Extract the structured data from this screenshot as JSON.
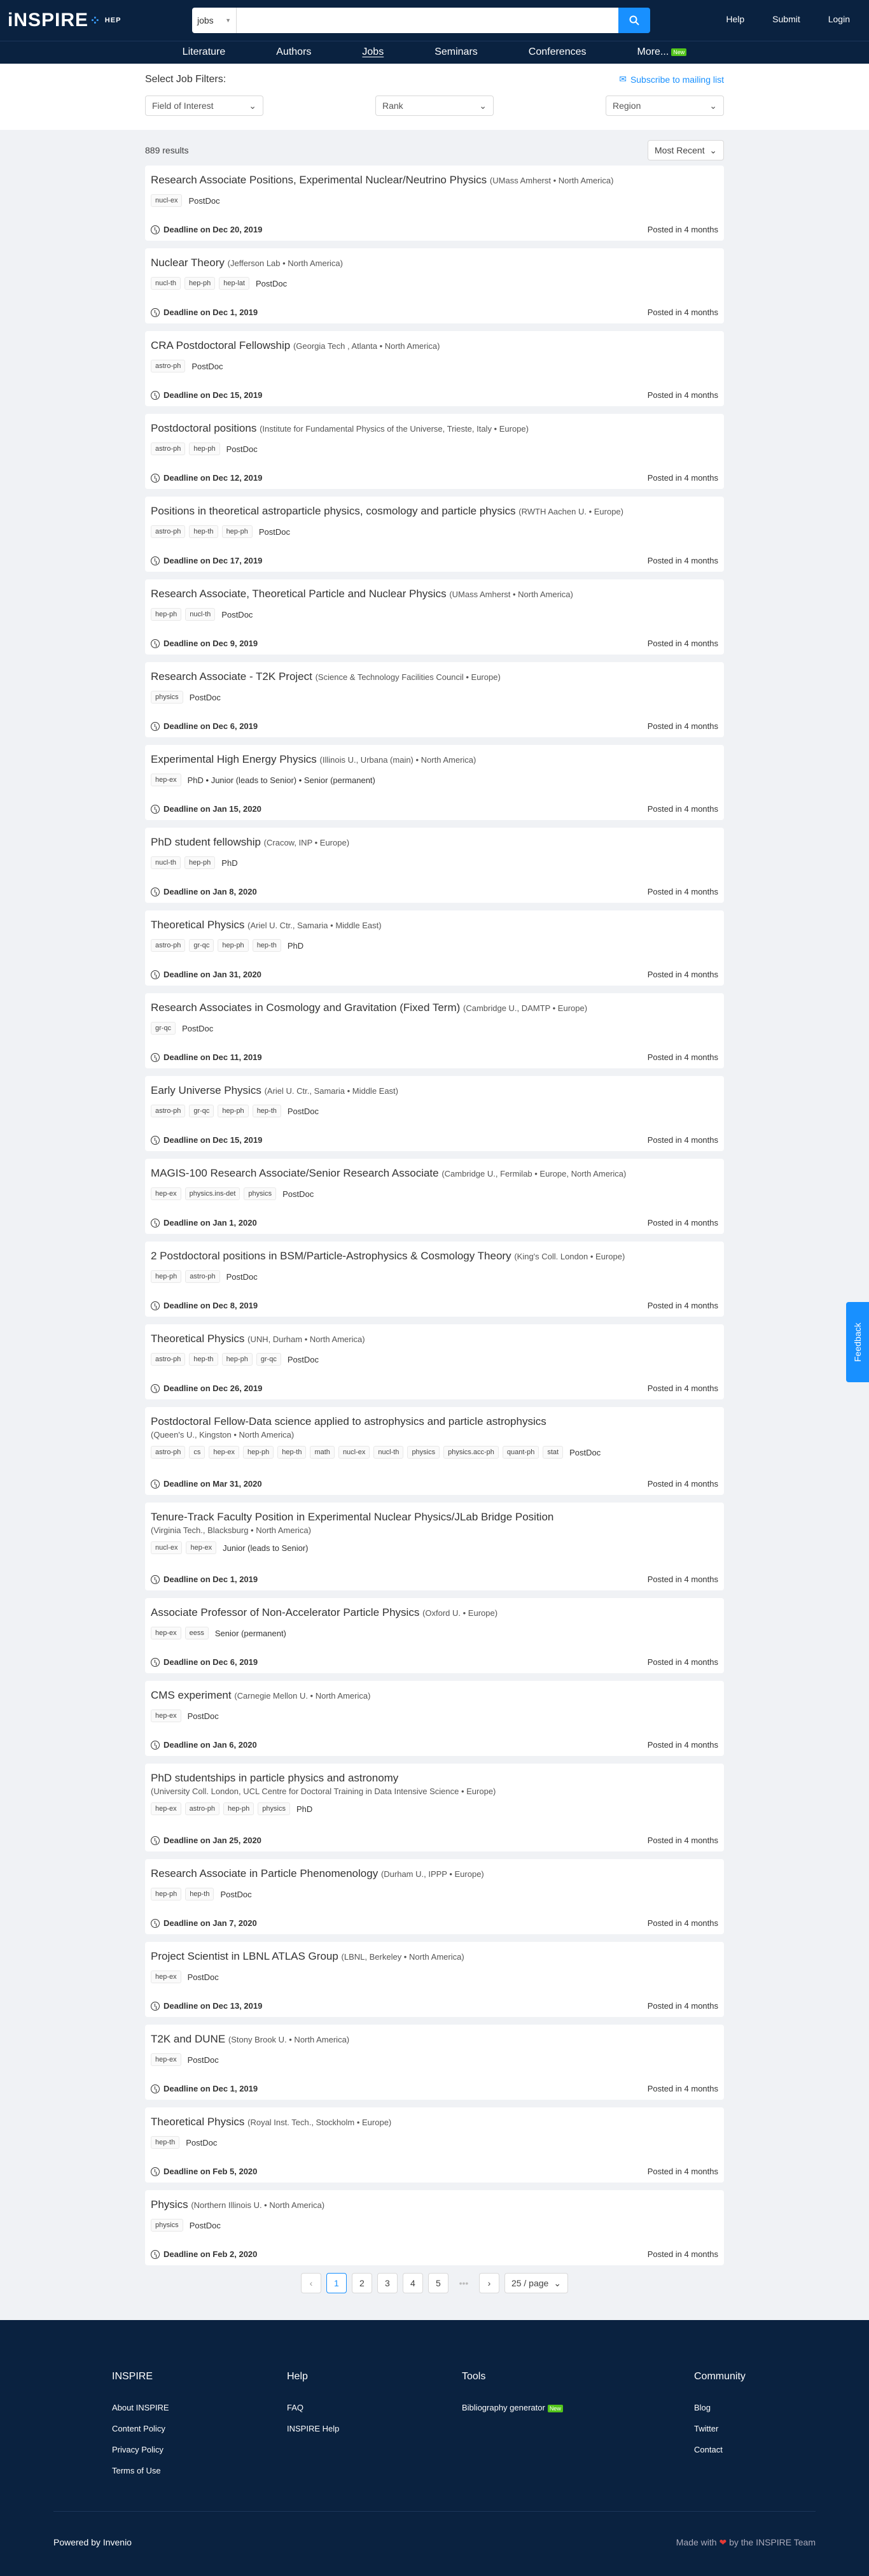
{
  "header": {
    "logo": "iNSPIRE",
    "logo_sub": "HEP",
    "search_scope": "jobs",
    "search_placeholder": "",
    "links": [
      "Help",
      "Submit",
      "Login"
    ],
    "nav": [
      "Literature",
      "Authors",
      "Jobs",
      "Seminars",
      "Conferences",
      "More..."
    ],
    "nav_new_badge": "New"
  },
  "filters": {
    "title": "Select Job Filters:",
    "subscribe": "Subscribe to mailing list",
    "field": "Field of Interest",
    "rank": "Rank",
    "region": "Region"
  },
  "results": {
    "count": "889 results",
    "sort": "Most Recent"
  },
  "jobs": [
    {
      "title": "Research Associate Positions, Experimental Nuclear/Neutrino Physics",
      "inst": "(UMass Amherst • North America)",
      "tags": [
        "nucl-ex"
      ],
      "rank": "PostDoc",
      "deadline": "Deadline on Dec 20, 2019",
      "posted": "Posted in 4 months"
    },
    {
      "title": "Nuclear Theory",
      "inst": "(Jefferson Lab • North America)",
      "tags": [
        "nucl-th",
        "hep-ph",
        "hep-lat"
      ],
      "rank": "PostDoc",
      "deadline": "Deadline on Dec 1, 2019",
      "posted": "Posted in 4 months"
    },
    {
      "title": "CRA Postdoctoral Fellowship",
      "inst": "(Georgia Tech , Atlanta • North America)",
      "tags": [
        "astro-ph"
      ],
      "rank": "PostDoc",
      "deadline": "Deadline on Dec 15, 2019",
      "posted": "Posted in 4 months"
    },
    {
      "title": "Postdoctoral positions",
      "inst": "(Institute for Fundamental Physics of the Universe, Trieste, Italy • Europe)",
      "tags": [
        "astro-ph",
        "hep-ph"
      ],
      "rank": "PostDoc",
      "deadline": "Deadline on Dec 12, 2019",
      "posted": "Posted in 4 months"
    },
    {
      "title": "Positions in theoretical astroparticle physics, cosmology and particle physics",
      "inst": "(RWTH Aachen U. • Europe)",
      "tags": [
        "astro-ph",
        "hep-th",
        "hep-ph"
      ],
      "rank": "PostDoc",
      "deadline": "Deadline on Dec 17, 2019",
      "posted": "Posted in 4 months"
    },
    {
      "title": "Research Associate, Theoretical Particle and Nuclear Physics",
      "inst": "(UMass Amherst • North America)",
      "tags": [
        "hep-ph",
        "nucl-th"
      ],
      "rank": "PostDoc",
      "deadline": "Deadline on Dec 9, 2019",
      "posted": "Posted in 4 months"
    },
    {
      "title": "Research Associate - T2K Project",
      "inst": "(Science & Technology Facilities Council • Europe)",
      "tags": [
        "physics"
      ],
      "rank": "PostDoc",
      "deadline": "Deadline on Dec 6, 2019",
      "posted": "Posted in 4 months"
    },
    {
      "title": "Experimental High Energy Physics",
      "inst": "(Illinois U., Urbana (main) • North America)",
      "tags": [
        "hep-ex"
      ],
      "rank": "PhD • Junior (leads to Senior) • Senior (permanent)",
      "deadline": "Deadline on Jan 15, 2020",
      "posted": "Posted in 4 months"
    },
    {
      "title": "PhD student fellowship",
      "inst": "(Cracow, INP • Europe)",
      "tags": [
        "nucl-th",
        "hep-ph"
      ],
      "rank": "PhD",
      "deadline": "Deadline on Jan 8, 2020",
      "posted": "Posted in 4 months"
    },
    {
      "title": "Theoretical Physics",
      "inst": "(Ariel U. Ctr., Samaria • Middle East)",
      "tags": [
        "astro-ph",
        "gr-qc",
        "hep-ph",
        "hep-th"
      ],
      "rank": "PhD",
      "deadline": "Deadline on Jan 31, 2020",
      "posted": "Posted in 4 months"
    },
    {
      "title": "Research Associates in Cosmology and Gravitation (Fixed Term)",
      "inst": "(Cambridge U., DAMTP • Europe)",
      "tags": [
        "gr-qc"
      ],
      "rank": "PostDoc",
      "deadline": "Deadline on Dec 11, 2019",
      "posted": "Posted in 4 months"
    },
    {
      "title": "Early Universe Physics",
      "inst": "(Ariel U. Ctr., Samaria • Middle East)",
      "tags": [
        "astro-ph",
        "gr-qc",
        "hep-ph",
        "hep-th"
      ],
      "rank": "PostDoc",
      "deadline": "Deadline on Dec 15, 2019",
      "posted": "Posted in 4 months"
    },
    {
      "title": "MAGIS-100 Research Associate/Senior Research Associate",
      "inst": "(Cambridge U., Fermilab • Europe, North America)",
      "tags": [
        "hep-ex",
        "physics.ins-det",
        "physics"
      ],
      "rank": "PostDoc",
      "deadline": "Deadline on Jan 1, 2020",
      "posted": "Posted in 4 months"
    },
    {
      "title": "2 Postdoctoral positions in BSM/Particle-Astrophysics & Cosmology Theory",
      "inst": "(King's Coll. London • Europe)",
      "tags": [
        "hep-ph",
        "astro-ph"
      ],
      "rank": "PostDoc",
      "deadline": "Deadline on Dec 8, 2019",
      "posted": "Posted in 4 months"
    },
    {
      "title": "Theoretical Physics",
      "inst": "(UNH, Durham • North America)",
      "tags": [
        "astro-ph",
        "hep-th",
        "hep-ph",
        "gr-qc"
      ],
      "rank": "PostDoc",
      "deadline": "Deadline on Dec 26, 2019",
      "posted": "Posted in 4 months"
    },
    {
      "title": "Postdoctoral Fellow-Data science applied to astrophysics and particle astrophysics",
      "inst2": "(Queen's U., Kingston • North America)",
      "tags": [
        "astro-ph",
        "cs",
        "hep-ex",
        "hep-ph",
        "hep-th",
        "math",
        "nucl-ex",
        "nucl-th",
        "physics",
        "physics.acc-ph",
        "quant-ph",
        "stat"
      ],
      "rank": "PostDoc",
      "deadline": "Deadline on Mar 31, 2020",
      "posted": "Posted in 4 months"
    },
    {
      "title": "Tenure-Track Faculty Position in Experimental Nuclear Physics/JLab Bridge Position",
      "inst2": "(Virginia Tech., Blacksburg • North America)",
      "tags": [
        "nucl-ex",
        "hep-ex"
      ],
      "rank": "Junior (leads to Senior)",
      "deadline": "Deadline on Dec 1, 2019",
      "posted": "Posted in 4 months"
    },
    {
      "title": "Associate Professor of Non-Accelerator Particle Physics",
      "inst": "(Oxford U. • Europe)",
      "tags": [
        "hep-ex",
        "eess"
      ],
      "rank": "Senior (permanent)",
      "deadline": "Deadline on Dec 6, 2019",
      "posted": "Posted in 4 months"
    },
    {
      "title": "CMS experiment",
      "inst": "(Carnegie Mellon U. • North America)",
      "tags": [
        "hep-ex"
      ],
      "rank": "PostDoc",
      "deadline": "Deadline on Jan 6, 2020",
      "posted": "Posted in 4 months"
    },
    {
      "title": "PhD studentships in particle physics and astronomy",
      "inst2": "(University Coll. London, UCL Centre for Doctoral Training in Data Intensive Science • Europe)",
      "tags": [
        "hep-ex",
        "astro-ph",
        "hep-ph",
        "physics"
      ],
      "rank": "PhD",
      "deadline": "Deadline on Jan 25, 2020",
      "posted": "Posted in 4 months"
    },
    {
      "title": "Research Associate in Particle Phenomenology",
      "inst": "(Durham U., IPPP • Europe)",
      "tags": [
        "hep-ph",
        "hep-th"
      ],
      "rank": "PostDoc",
      "deadline": "Deadline on Jan 7, 2020",
      "posted": "Posted in 4 months"
    },
    {
      "title": "Project Scientist in LBNL ATLAS Group",
      "inst": "(LBNL, Berkeley • North America)",
      "tags": [
        "hep-ex"
      ],
      "rank": "PostDoc",
      "deadline": "Deadline on Dec 13, 2019",
      "posted": "Posted in 4 months"
    },
    {
      "title": "T2K and DUNE",
      "inst": "(Stony Brook U. • North America)",
      "tags": [
        "hep-ex"
      ],
      "rank": "PostDoc",
      "deadline": "Deadline on Dec 1, 2019",
      "posted": "Posted in 4 months"
    },
    {
      "title": "Theoretical Physics",
      "inst": "(Royal Inst. Tech., Stockholm • Europe)",
      "tags": [
        "hep-th"
      ],
      "rank": "PostDoc",
      "deadline": "Deadline on Feb 5, 2020",
      "posted": "Posted in 4 months"
    },
    {
      "title": "Physics",
      "inst": "(Northern Illinois U. • North America)",
      "tags": [
        "physics"
      ],
      "rank": "PostDoc",
      "deadline": "Deadline on Feb 2, 2020",
      "posted": "Posted in 4 months"
    }
  ],
  "pagination": {
    "pages": [
      "1",
      "2",
      "3",
      "4",
      "5"
    ],
    "ellipsis": "•••",
    "current": "1",
    "size": "25 / page"
  },
  "feedback": "Feedback",
  "footer": {
    "cols": [
      {
        "title": "INSPIRE",
        "links": [
          "About INSPIRE",
          "Content Policy",
          "Privacy Policy",
          "Terms of Use"
        ]
      },
      {
        "title": "Help",
        "links": [
          "FAQ",
          "INSPIRE Help"
        ]
      },
      {
        "title": "Tools",
        "links": [
          "Bibliography generator"
        ]
      },
      {
        "title": "Community",
        "links": [
          "Blog",
          "Twitter",
          "Contact"
        ]
      }
    ],
    "new_badge": "New",
    "powered": "Powered by Invenio",
    "made": "Made with",
    "made_by": "by the INSPIRE Team"
  }
}
